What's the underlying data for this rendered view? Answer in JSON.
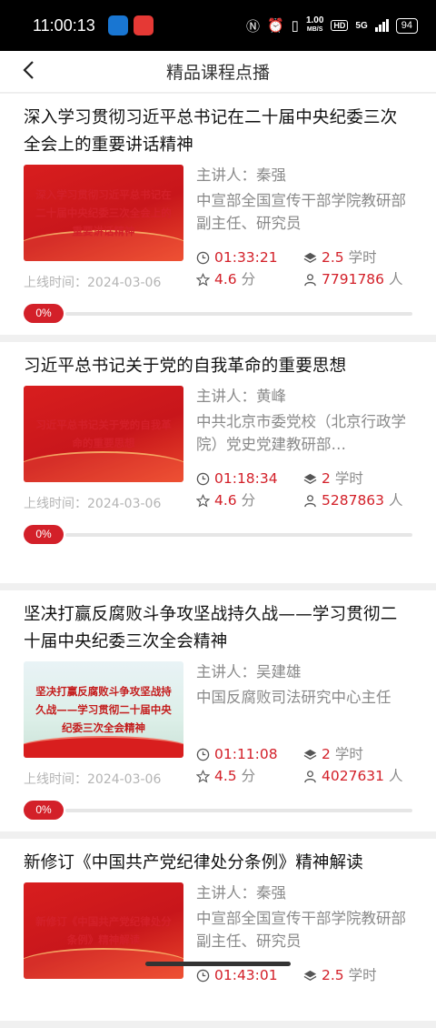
{
  "status_bar": {
    "time": "11:00:13",
    "net_speed": "1.00",
    "net_unit": "MB/S",
    "hd": "HD",
    "signal": "5G",
    "battery": "94"
  },
  "header": {
    "title": "精品课程点播"
  },
  "labels": {
    "lecturer_prefix": "主讲人：",
    "online_prefix": "上线时间：",
    "hours_unit": "学时",
    "score_unit": "分",
    "people_unit": "人"
  },
  "courses": [
    {
      "title": "深入学习贯彻习近平总书记在二十届中央纪委三次全会上的重要讲话精神",
      "thumb_text": "深入学习贯彻习近平总书记在二十届中央纪委三次全会上的重要讲话精神",
      "lecturer": "秦强",
      "org": "中宣部全国宣传干部学院教研部副主任、研究员",
      "duration": "01:33:21",
      "hours": "2.5",
      "score": "4.6",
      "views": "7791786",
      "date": "2024-03-06",
      "progress": "0%"
    },
    {
      "title": "习近平总书记关于党的自我革命的重要思想",
      "thumb_text": "习近平总书记关于党的自我革命的重要思想",
      "lecturer": "黄峰",
      "org": "中共北京市委党校（北京行政学院）党史党建教研部…",
      "duration": "01:18:34",
      "hours": "2",
      "score": "4.6",
      "views": "5287863",
      "date": "2024-03-06",
      "progress": "0%"
    },
    {
      "title": "坚决打赢反腐败斗争攻坚战持久战——学习贯彻二十届中央纪委三次全会精神",
      "thumb_text": "坚决打赢反腐败斗争攻坚战持久战——学习贯彻二十届中央纪委三次全会精神",
      "lecturer": "吴建雄",
      "org": "中国反腐败司法研究中心主任",
      "duration": "01:11:08",
      "hours": "2",
      "score": "4.5",
      "views": "4027631",
      "date": "2024-03-06",
      "progress": "0%"
    },
    {
      "title": "新修订《中国共产党纪律处分条例》精神解读",
      "thumb_text": "新修订《中国共产党纪律处分条例》精神解读",
      "lecturer": "秦强",
      "org": "中宣部全国宣传干部学院教研部副主任、研究员",
      "duration": "01:43:01",
      "hours": "2.5"
    }
  ],
  "colors": {
    "accent": "#d32029",
    "muted": "#8a8a8a"
  }
}
